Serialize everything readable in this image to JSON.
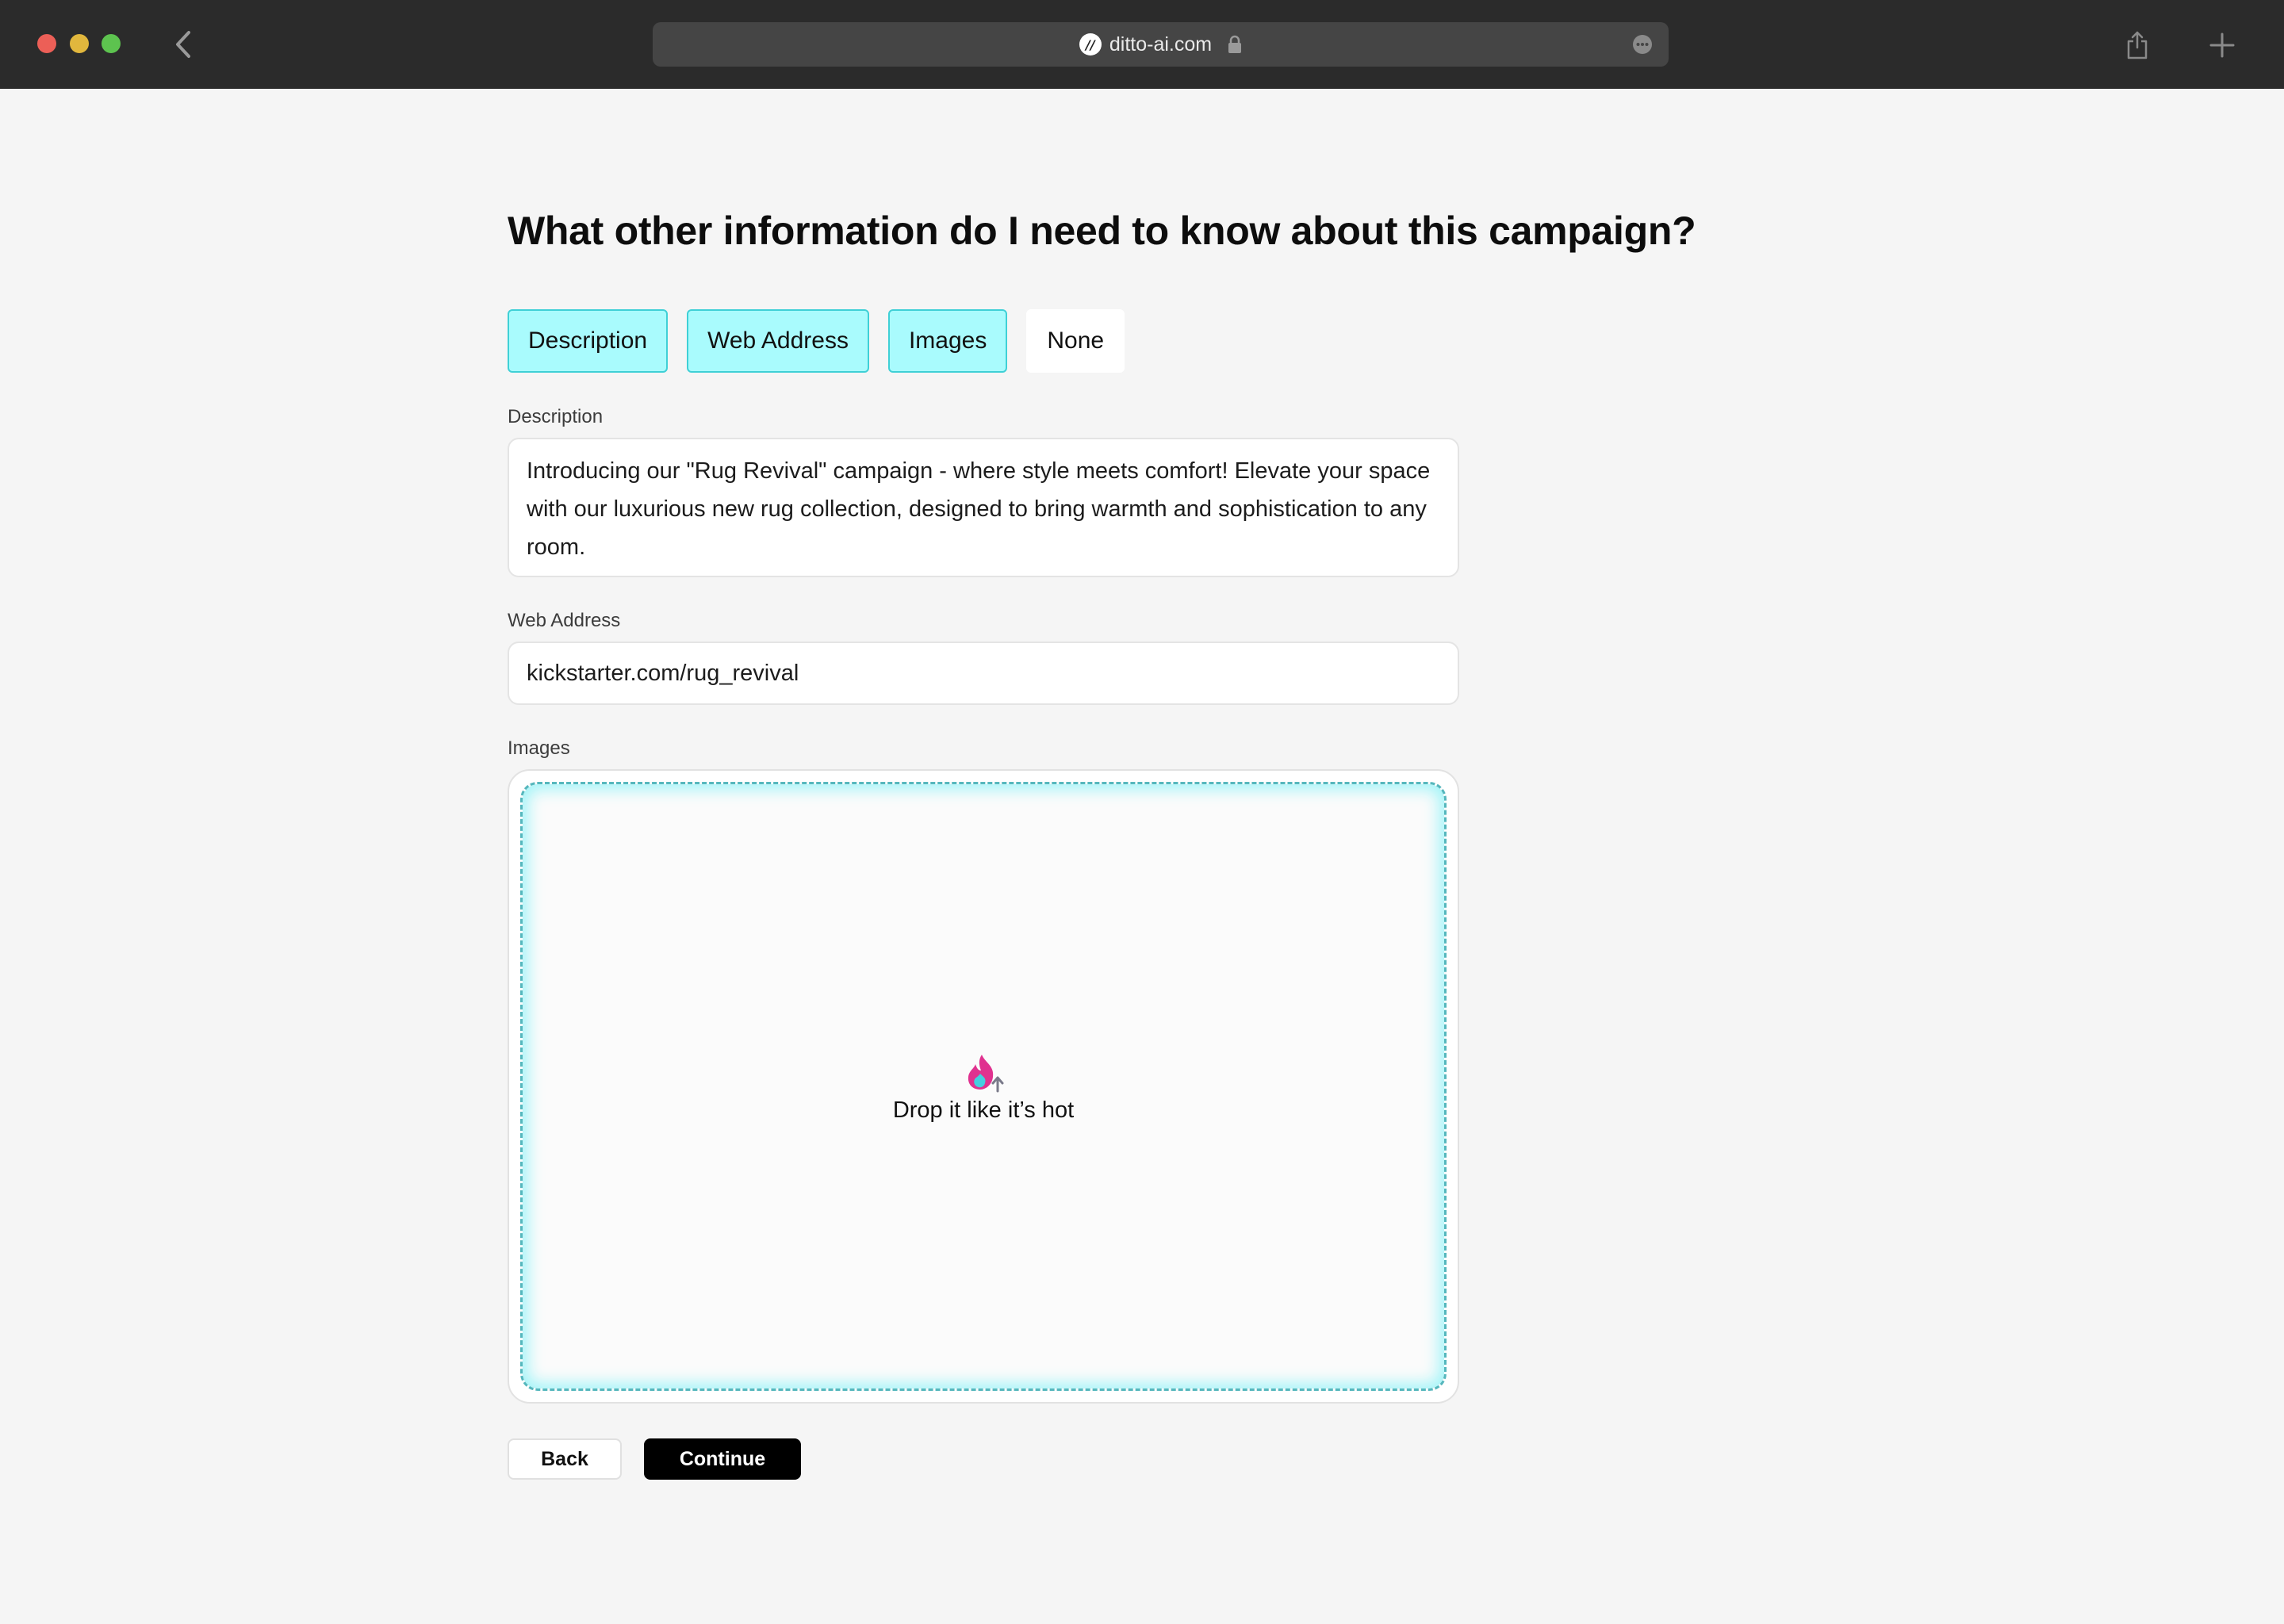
{
  "browser": {
    "url": "ditto-ai.com",
    "site_icon_glyph": "//",
    "icons": {
      "back": "chevron-left-icon",
      "lock": "lock-icon",
      "more": "more-icon",
      "share": "share-icon",
      "new_tab": "plus-icon"
    }
  },
  "page": {
    "title": "What other information do I need to know about this campaign?",
    "chips": [
      {
        "label": "Description",
        "selected": true
      },
      {
        "label": "Web Address",
        "selected": true
      },
      {
        "label": "Images",
        "selected": true
      },
      {
        "label": "None",
        "selected": false
      }
    ],
    "description": {
      "label": "Description",
      "value": "Introducing our \"Rug Revival\" campaign - where style meets comfort! Elevate your space with our luxurious new rug collection, designed to bring warmth and sophistication to any room."
    },
    "web_address": {
      "label": "Web Address",
      "value": "kickstarter.com/rug_revival"
    },
    "images": {
      "label": "Images",
      "drop_text": "Drop it like it’s hot",
      "icon": "flame-upload-icon"
    },
    "buttons": {
      "back": "Back",
      "continue": "Continue"
    }
  },
  "colors": {
    "chip_selected_bg": "#a9fbfd",
    "chip_selected_border": "#3fd0d6",
    "dropzone_glow": "#9ff4f8",
    "primary_button": "#000000"
  }
}
